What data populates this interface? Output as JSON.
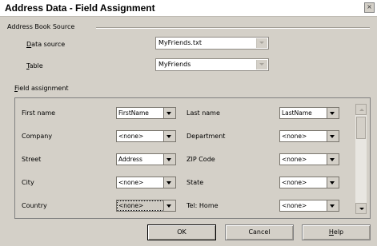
{
  "window": {
    "title": "Address Data - Field Assignment",
    "close_glyph": "×"
  },
  "source_section": {
    "heading": "Address Book Source",
    "data_source_label": "Data source",
    "data_source_value": "MyFriends.txt",
    "table_label": "Table",
    "table_value": "MyFriends"
  },
  "field_assignment": {
    "heading": "Field assignment",
    "rows": [
      {
        "left_label": "First name",
        "left_value": "FirstName",
        "right_label": "Last name",
        "right_value": "LastName"
      },
      {
        "left_label": "Company",
        "left_value": "<none>",
        "right_label": "Department",
        "right_value": "<none>"
      },
      {
        "left_label": "Street",
        "left_value": "Address",
        "right_label": "ZIP Code",
        "right_value": "<none>"
      },
      {
        "left_label": "City",
        "left_value": "<none>",
        "right_label": "State",
        "right_value": "<none>"
      },
      {
        "left_label": "Country",
        "left_value": "<none>",
        "right_label": "Tel: Home",
        "right_value": "<none>"
      }
    ]
  },
  "buttons": {
    "ok": "OK",
    "cancel": "Cancel",
    "help": "Help"
  }
}
